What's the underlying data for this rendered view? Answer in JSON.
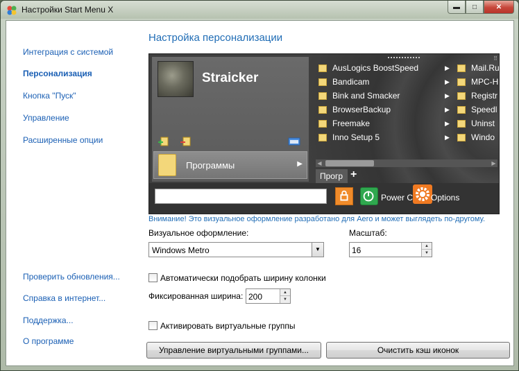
{
  "window": {
    "title": "Настройки Start Menu X",
    "min_label": "▬",
    "max_label": "□",
    "close_label": "✕"
  },
  "sidebar": {
    "items": [
      {
        "label": "Интеграция с системой"
      },
      {
        "label": "Персонализация"
      },
      {
        "label": "Кнопка \"Пуск\""
      },
      {
        "label": "Управление"
      },
      {
        "label": "Расширенные опции"
      }
    ],
    "links": [
      {
        "label": "Проверить обновления..."
      },
      {
        "label": "Справка в интернет..."
      },
      {
        "label": "Поддержка..."
      },
      {
        "label": "О программе"
      }
    ]
  },
  "main": {
    "heading": "Настройка персонализации",
    "preview": {
      "username": "Straicker",
      "programs_label": "Программы",
      "menu_col1": [
        "AusLogics BoostSpeed",
        "Bandicam",
        "Bink and Smacker",
        "BrowserBackup",
        "Freemake",
        "Inno Setup 5"
      ],
      "menu_col2": [
        "Mail.Ru",
        "MPC-HC",
        "Registr",
        "Speedl",
        "Uninst",
        "Windo"
      ],
      "tab_label": "Прогр",
      "tab_plus": "+",
      "power_label": "Power C",
      "options_label": "Options"
    },
    "warning": "Внимание! Это визуальное оформление разработано для Aero и может выглядеть по-другому.",
    "theme_label": "Визуальное оформление:",
    "theme_value": "Windows Metro",
    "scale_label": "Масштаб:",
    "scale_value": "16",
    "auto_width_label": "Автоматически подобрать ширину колонки",
    "auto_width_checked": false,
    "fixed_width_label": "Фиксированная ширина:",
    "fixed_width_value": "200",
    "virtual_groups_label": "Активировать виртуальные группы",
    "virtual_groups_checked": false,
    "manage_groups_button": "Управление виртуальными группами...",
    "clear_cache_button": "Очистить кэш иконок"
  },
  "colors": {
    "accent": "#1f6cb5",
    "warning": "#1f6cb5",
    "power": "#2fa84f",
    "lock": "#f08b2a"
  }
}
